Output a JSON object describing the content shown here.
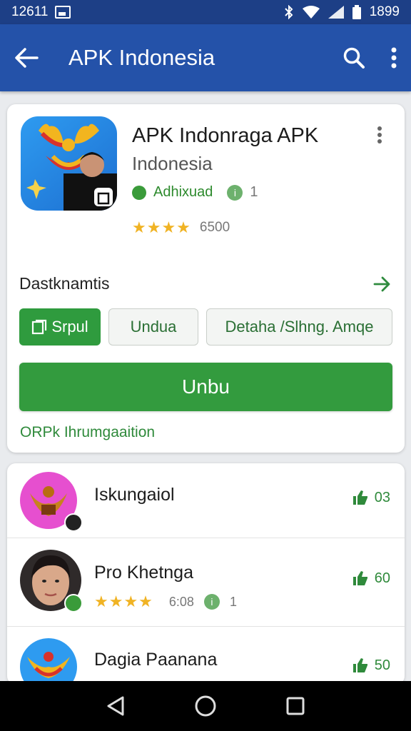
{
  "status": {
    "time": "12611",
    "battery": "1899"
  },
  "app_bar": {
    "title": "APK Indonesia"
  },
  "app_card": {
    "name": "APK Indonraga APK",
    "developer": "Indonesia",
    "badge": "Adhixuad",
    "badge_count": "1",
    "rating_stars": "★★★★",
    "rating_value": "6500",
    "section_title": "Dastknamtis",
    "chips": [
      "Srpul",
      "Undua",
      "Detaha /Slhng. Amqe"
    ],
    "primary_button": "Unbu",
    "footer_link": "ORPk Ihrumgaaition"
  },
  "list": [
    {
      "name": "Iskungaiol",
      "likes": "03"
    },
    {
      "name": "Pro Khetnga",
      "likes": "60",
      "stars": "★★★★",
      "meta": "6:08",
      "badge_count": "1"
    },
    {
      "name": "Dagia Paanana",
      "likes": "50"
    }
  ],
  "colors": {
    "app_bar": "#2452a9",
    "status_bar": "#1d3f86",
    "accent_green": "#339b3e"
  }
}
